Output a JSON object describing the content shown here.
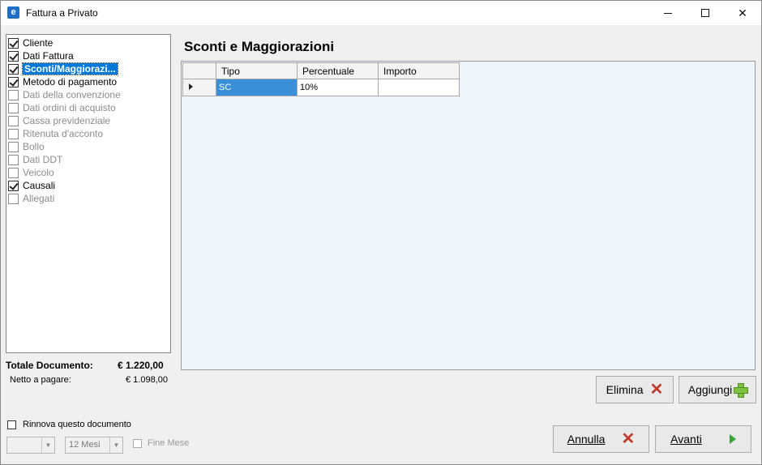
{
  "window": {
    "title": "Fattura a Privato",
    "icon": "app-logo-icon",
    "app_icon_glyph": "e"
  },
  "steps": [
    {
      "label": "Cliente",
      "checked": true,
      "enabled": true,
      "selected": false
    },
    {
      "label": "Dati Fattura",
      "checked": true,
      "enabled": true,
      "selected": false
    },
    {
      "label": "Sconti/Maggiorazi...",
      "checked": true,
      "enabled": true,
      "selected": true
    },
    {
      "label": "Metodo di pagamento",
      "checked": true,
      "enabled": true,
      "selected": false
    },
    {
      "label": "Dati della convenzione",
      "checked": false,
      "enabled": false,
      "selected": false
    },
    {
      "label": "Dati ordini di acquisto",
      "checked": false,
      "enabled": false,
      "selected": false
    },
    {
      "label": "Cassa previdenziale",
      "checked": false,
      "enabled": false,
      "selected": false
    },
    {
      "label": "Ritenuta d'acconto",
      "checked": false,
      "enabled": false,
      "selected": false
    },
    {
      "label": "Bollo",
      "checked": false,
      "enabled": false,
      "selected": false
    },
    {
      "label": "Dati DDT",
      "checked": false,
      "enabled": false,
      "selected": false
    },
    {
      "label": "Veicolo",
      "checked": false,
      "enabled": false,
      "selected": false
    },
    {
      "label": "Causali",
      "checked": true,
      "enabled": true,
      "selected": false
    },
    {
      "label": "Allegati",
      "checked": false,
      "enabled": false,
      "selected": false
    }
  ],
  "totals": {
    "total_label": "Totale Documento:",
    "total_value": "€ 1.220,00",
    "net_label": "Netto a pagare:",
    "net_value": "€ 1.098,00"
  },
  "renew": {
    "label": "Rinnova questo documento",
    "checked": false,
    "combo1_value": "",
    "combo2_value": "12 Mesi",
    "fine_mese_label": "Fine Mese",
    "fine_mese_checked": false
  },
  "section": {
    "title": "Sconti e Maggiorazioni"
  },
  "grid": {
    "columns": [
      "Tipo",
      "Percentuale",
      "Importo"
    ],
    "rows": [
      {
        "tipo": "SC",
        "percentuale": "10%",
        "importo": ""
      }
    ]
  },
  "buttons": {
    "elimina": "Elimina",
    "aggiungi": "Aggiungi",
    "annulla": "Annulla",
    "avanti": "Avanti"
  },
  "colors": {
    "selection": "#0078d7",
    "cell_selection": "#3a8fd9",
    "grid_background": "#eef4fb",
    "delete_red": "#c0392b",
    "add_green": "#7ec242"
  }
}
